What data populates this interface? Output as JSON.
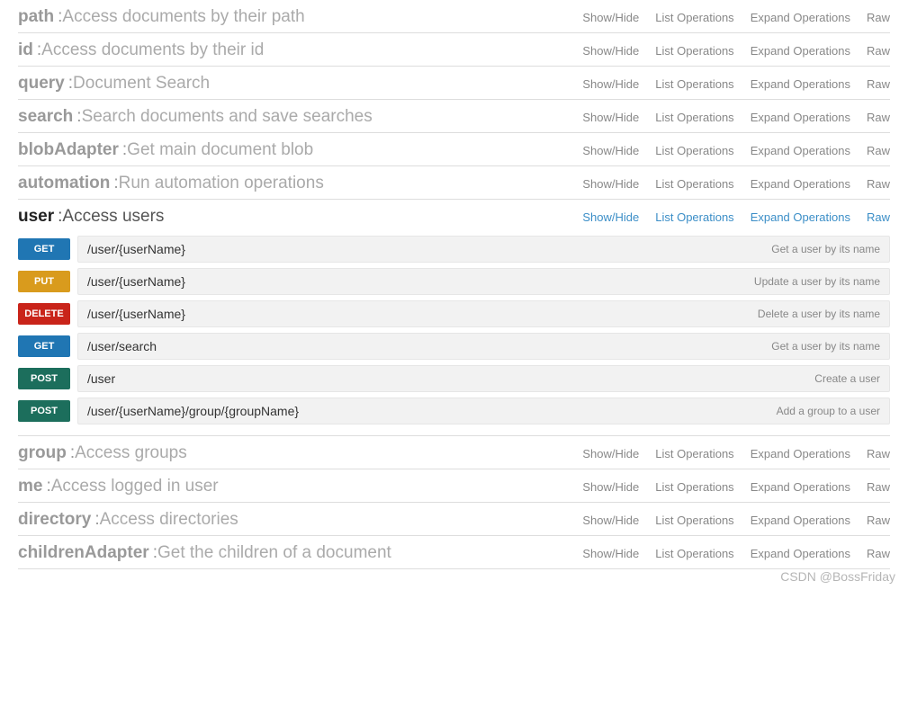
{
  "actions": {
    "showHide": "Show/Hide",
    "listOps": "List Operations",
    "expandOps": "Expand Operations",
    "raw": "Raw"
  },
  "resources": [
    {
      "name": "path",
      "desc": "Access documents by their path",
      "active": false
    },
    {
      "name": "id",
      "desc": "Access documents by their id",
      "active": false
    },
    {
      "name": "query",
      "desc": "Document Search",
      "active": false
    },
    {
      "name": "search",
      "desc": "Search documents and save searches",
      "active": false
    },
    {
      "name": "blobAdapter",
      "desc": "Get main document blob",
      "active": false
    },
    {
      "name": "automation",
      "desc": "Run automation operations",
      "active": false
    },
    {
      "name": "user",
      "desc": "Access users",
      "active": true,
      "operations": [
        {
          "method": "GET",
          "path": "/user/{userName}",
          "desc": "Get a user by its name"
        },
        {
          "method": "PUT",
          "path": "/user/{userName}",
          "desc": "Update a user by its name"
        },
        {
          "method": "DELETE",
          "path": "/user/{userName}",
          "desc": "Delete a user by its name"
        },
        {
          "method": "GET",
          "path": "/user/search",
          "desc": "Get a user by its name"
        },
        {
          "method": "POST",
          "path": "/user",
          "desc": "Create a user"
        },
        {
          "method": "POST",
          "path": "/user/{userName}/group/{groupName}",
          "desc": "Add a group to a user"
        }
      ]
    },
    {
      "name": "group",
      "desc": "Access groups",
      "active": false
    },
    {
      "name": "me",
      "desc": "Access logged in user",
      "active": false
    },
    {
      "name": "directory",
      "desc": "Access directories",
      "active": false
    },
    {
      "name": "childrenAdapter",
      "desc": "Get the children of a document",
      "active": false
    }
  ],
  "watermark": "CSDN @BossFriday"
}
